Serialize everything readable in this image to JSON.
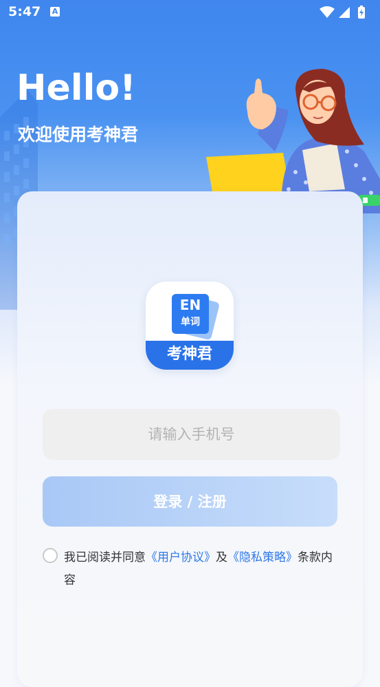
{
  "status_bar": {
    "time": "5:47",
    "icons": [
      "a-notification-icon",
      "wifi-icon",
      "cellular-signal-icon",
      "battery-charging-icon"
    ]
  },
  "hero": {
    "title": "Hello!",
    "subtitle": "欢迎使用考神君"
  },
  "logo": {
    "en_text": "EN",
    "cn_text": "单词",
    "brand": "考神君"
  },
  "phone_input": {
    "value": "",
    "placeholder": "请输入手机号"
  },
  "login_button": {
    "label": "登录 / 注册"
  },
  "agreement": {
    "prefix": "我已阅读并同意",
    "user_agreement": "《用户协议》",
    "and": "及",
    "privacy_policy": "《隐私策略》",
    "suffix": "条款内容",
    "checked": false
  },
  "colors": {
    "primary": "#2f78e6",
    "hero_blue": "#3f86ee",
    "button_disabled": "#a9c8f6",
    "input_bg": "#efefef"
  }
}
